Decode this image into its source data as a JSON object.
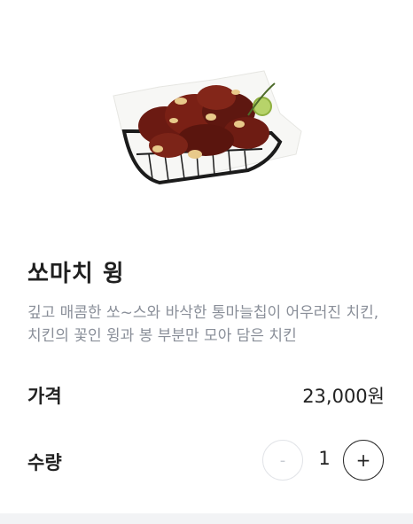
{
  "product": {
    "name": "쏘마치 윙",
    "description": "깊고 매콤한 쏘~스와 바삭한 통마늘칩이 어우러진 치킨, 치킨의 꽃인 윙과 봉 부분만 모아 담은 치킨",
    "image_alt": "chicken-wings-in-basket"
  },
  "price": {
    "label": "가격",
    "value": "23,000원"
  },
  "quantity": {
    "label": "수량",
    "minus_label": "-",
    "value": "1",
    "plus_label": "+"
  },
  "colors": {
    "description_text": "#8a8f99",
    "minus_disabled": "#c8ccd2",
    "basket": "#1b1b1b",
    "sauce": "#6b1a12"
  }
}
